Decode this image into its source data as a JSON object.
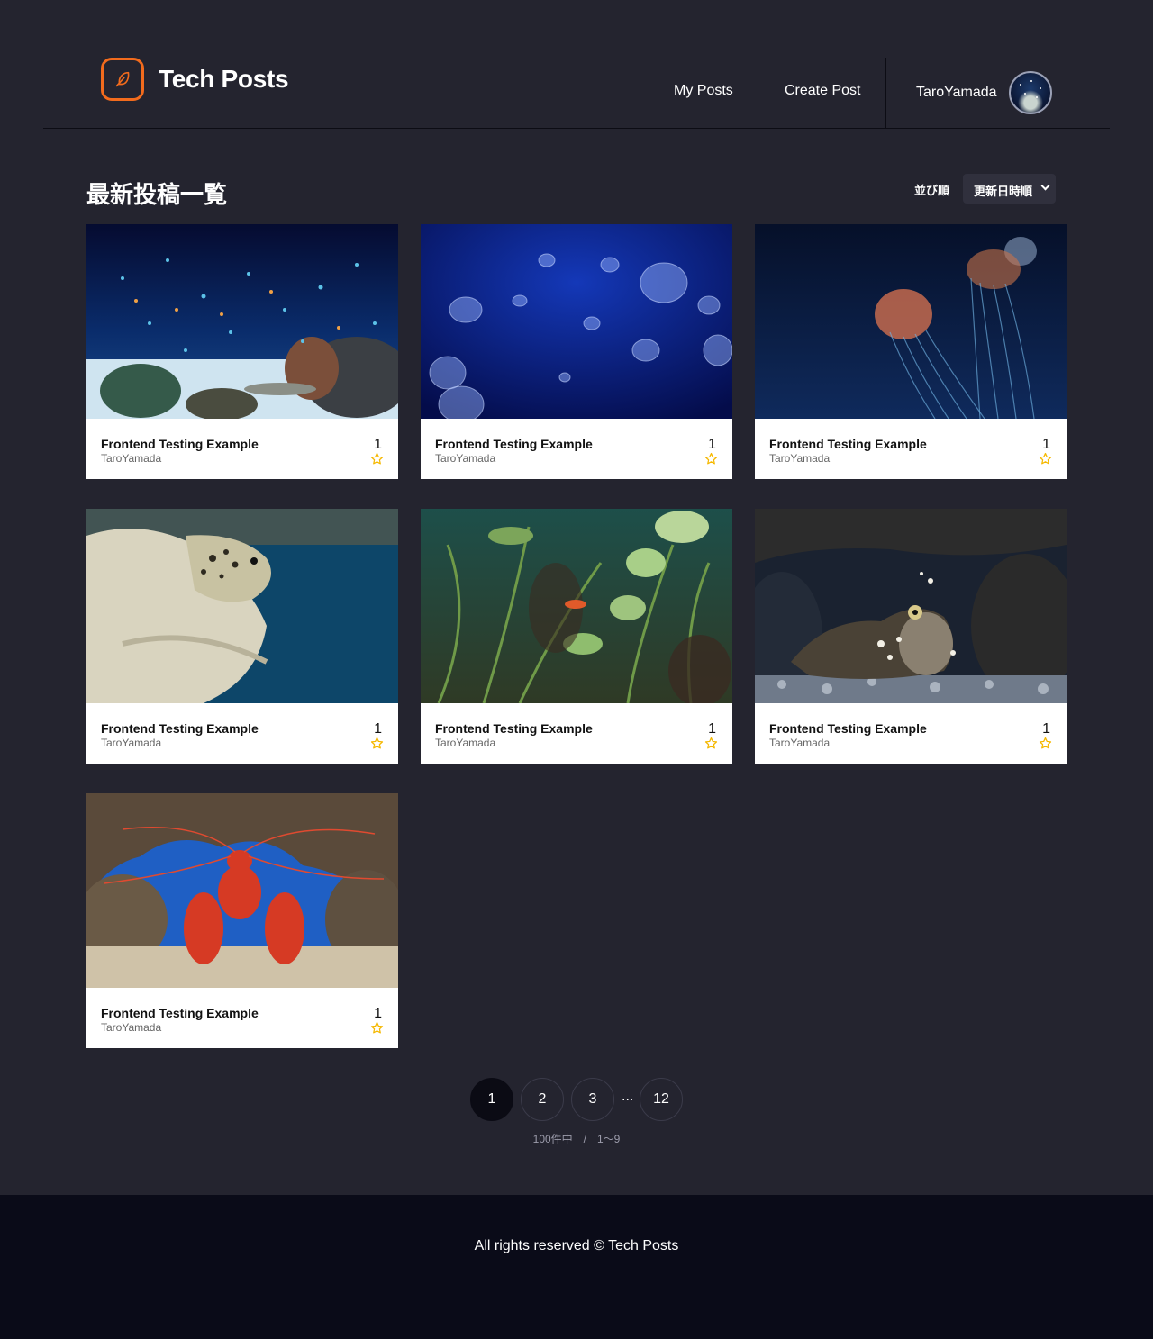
{
  "header": {
    "site_title": "Tech Posts",
    "logo_icon": "feather-icon",
    "nav": {
      "my_posts": "My Posts",
      "create_post": "Create Post"
    },
    "user": {
      "name": "TaroYamada"
    }
  },
  "main": {
    "heading": "最新投稿一覧",
    "sort": {
      "label": "並び順",
      "selected": "更新日時順"
    },
    "posts": [
      {
        "title": "Frontend Testing Example",
        "author": "TaroYamada",
        "likes": "1",
        "image": "aquarium-fish-reef"
      },
      {
        "title": "Frontend Testing Example",
        "author": "TaroYamada",
        "likes": "1",
        "image": "moon-jellyfish"
      },
      {
        "title": "Frontend Testing Example",
        "author": "TaroYamada",
        "likes": "1",
        "image": "sea-nettle-jellyfish"
      },
      {
        "title": "Frontend Testing Example",
        "author": "TaroYamada",
        "likes": "1",
        "image": "sea-turtle"
      },
      {
        "title": "Frontend Testing Example",
        "author": "TaroYamada",
        "likes": "1",
        "image": "aquatic-plants-fish"
      },
      {
        "title": "Frontend Testing Example",
        "author": "TaroYamada",
        "likes": "1",
        "image": "scorpionfish"
      },
      {
        "title": "Frontend Testing Example",
        "author": "TaroYamada",
        "likes": "1",
        "image": "red-lobster"
      }
    ]
  },
  "pagination": {
    "pages": [
      "1",
      "2",
      "3",
      "12"
    ],
    "current": "1",
    "ellipsis": "...",
    "summary": "100件中　/　1〜9"
  },
  "footer": {
    "text": "All rights reserved © Tech Posts"
  },
  "colors": {
    "background": "#24242f",
    "accent": "#f26b1d",
    "star": "#f5b800",
    "footer": "#0a0b18"
  }
}
